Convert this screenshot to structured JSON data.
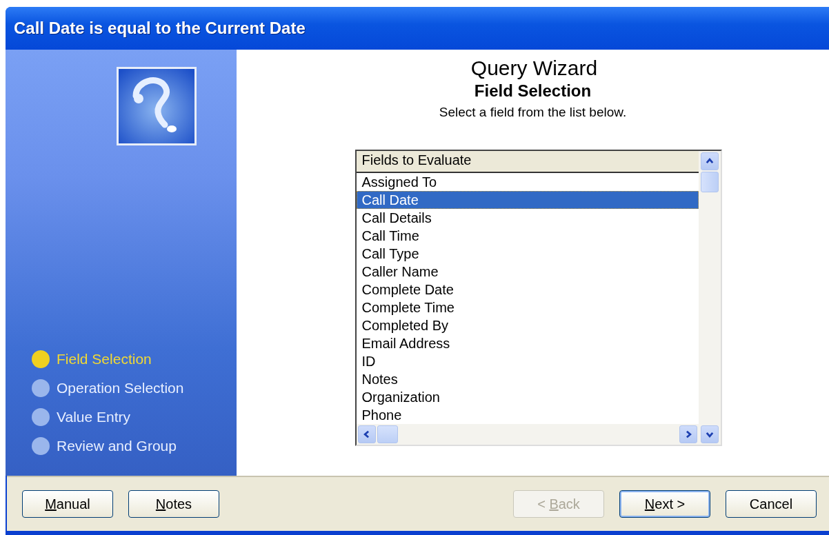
{
  "window": {
    "title": "Call Date is equal to the Current Date"
  },
  "steps": [
    {
      "label": "Field Selection",
      "selected": true
    },
    {
      "label": "Operation Selection",
      "selected": false
    },
    {
      "label": "Value Entry",
      "selected": false
    },
    {
      "label": "Review and Group",
      "selected": false
    }
  ],
  "header": {
    "title": "Query Wizard",
    "subtitle": "Field Selection",
    "instruction": "Select a field from the list below."
  },
  "list": {
    "column": "Fields to Evaluate",
    "items": [
      {
        "label": "Assigned To",
        "selected": false
      },
      {
        "label": "Call Date",
        "selected": true
      },
      {
        "label": "Call Details",
        "selected": false
      },
      {
        "label": "Call Time",
        "selected": false
      },
      {
        "label": "Call Type",
        "selected": false
      },
      {
        "label": "Caller Name",
        "selected": false
      },
      {
        "label": "Complete Date",
        "selected": false
      },
      {
        "label": "Complete Time",
        "selected": false
      },
      {
        "label": "Completed By",
        "selected": false
      },
      {
        "label": "Email Address",
        "selected": false
      },
      {
        "label": "ID",
        "selected": false
      },
      {
        "label": "Notes",
        "selected": false
      },
      {
        "label": "Organization",
        "selected": false
      },
      {
        "label": "Phone",
        "selected": false
      }
    ]
  },
  "buttons_left": [
    {
      "key": "M",
      "rest": "anual",
      "disabled": false,
      "default": false
    },
    {
      "key": "N",
      "rest": "otes",
      "disabled": false,
      "default": false
    }
  ],
  "buttons_right": [
    {
      "pre": "< ",
      "key": "B",
      "rest": "ack",
      "disabled": true,
      "default": false
    },
    {
      "key": "N",
      "rest": "ext >",
      "disabled": false,
      "default": true
    },
    {
      "pre": "Cancel",
      "disabled": false,
      "default": false
    }
  ]
}
